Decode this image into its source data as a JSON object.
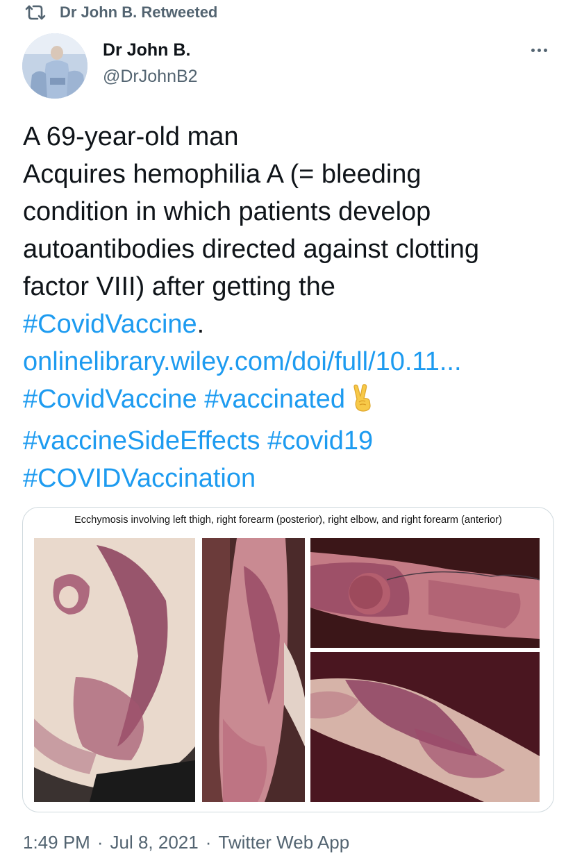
{
  "retweet": {
    "label": "Dr John B. Retweeted",
    "icon": "retweet-icon"
  },
  "author": {
    "name": "Dr John B.",
    "handle": "@DrJohnB2"
  },
  "tweet": {
    "line1": "A 69-year-old man",
    "line2": "Acquires hemophilia A (= bleeding",
    "line3": "condition in which patients develop",
    "line4": "autoantibodies directed against clotting",
    "line5": "factor VIII) after getting the",
    "hashtag_covidvaccine_1": "#CovidVaccine",
    "period": ".",
    "link": "onlinelibrary.wiley.com/doi/full/10.11...",
    "hashtag_covidvaccine_2": "#CovidVaccine",
    "hashtag_vaccinated": "#vaccinated",
    "emoji": "victory-hand-emoji",
    "hashtag_sideeffects": "#vaccineSideEffects",
    "hashtag_covid19": "#covid19",
    "hashtag_covidvaccination": "#COVIDVaccination"
  },
  "media": {
    "caption": "Ecchymosis involving left thigh, right forearm (posterior), right elbow, and right forearm (anterior)"
  },
  "meta": {
    "time": "1:49 PM",
    "sep1": "·",
    "date": "Jul 8, 2021",
    "sep2": "·",
    "source": "Twitter Web App"
  },
  "colors": {
    "link": "#1d9bf0",
    "secondary_text": "#536471",
    "text": "#0f1419",
    "border": "#cfd9de"
  }
}
